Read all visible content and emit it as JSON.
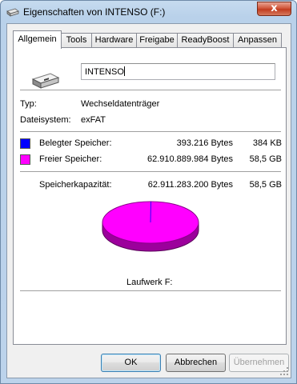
{
  "window": {
    "title": "Eigenschaften von INTENSO (F:)",
    "close_glyph": "x"
  },
  "tabs": [
    {
      "label": "Allgemein",
      "active": true
    },
    {
      "label": "Tools",
      "active": false
    },
    {
      "label": "Hardware",
      "active": false
    },
    {
      "label": "Freigabe",
      "active": false
    },
    {
      "label": "ReadyBoost",
      "active": false
    },
    {
      "label": "Anpassen",
      "active": false
    }
  ],
  "general": {
    "drive_icon": "removable-drive-icon",
    "name_value": "INTENSO",
    "type_label": "Typ:",
    "type_value": "Wechseldatenträger",
    "fs_label": "Dateisystem:",
    "fs_value": "exFAT",
    "used_label": "Belegter Speicher:",
    "used_bytes": "393.216 Bytes",
    "used_short": "384 KB",
    "used_color": "#0000ff",
    "free_label": "Freier Speicher:",
    "free_bytes": "62.910.889.984 Bytes",
    "free_short": "58,5 GB",
    "free_color": "#ff00ff",
    "capacity_label": "Speicherkapazität:",
    "capacity_bytes": "62.911.283.200 Bytes",
    "capacity_short": "58,5 GB",
    "drive_label": "Laufwerk F:"
  },
  "buttons": {
    "ok": "OK",
    "cancel": "Abbrechen",
    "apply": "Übernehmen"
  }
}
